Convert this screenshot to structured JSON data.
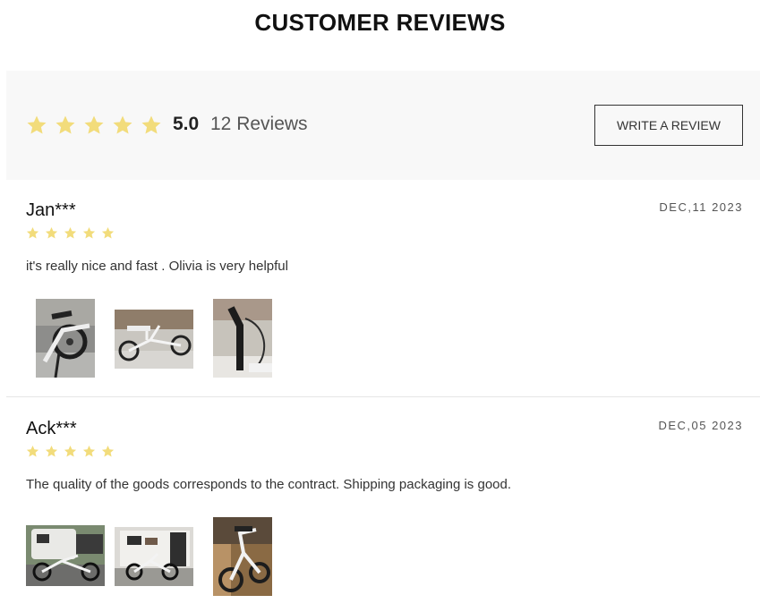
{
  "header": {
    "title": "CUSTOMER REVIEWS"
  },
  "summary": {
    "rating": "5.0",
    "rating_stars": 5,
    "count_text": "12 Reviews",
    "write_button": "WRITE A REVIEW",
    "star_color": "#f2dc7b"
  },
  "reviews": [
    {
      "name": "Jan***",
      "date": "DEC,11 2023",
      "stars": 5,
      "text": "it's really nice and fast . Olivia is very helpful",
      "photos": [
        "bike-rear-wheel-photo",
        "bike-cargo-side-photo",
        "bike-handlebar-photo"
      ]
    },
    {
      "name": "Ack***",
      "date": "DEC,05 2023",
      "stars": 5,
      "text": "The quality of the goods corresponds to the contract. Shipping packaging is good.",
      "photos": [
        "bike-with-caravan-photo",
        "bike-at-caravan-door-photo",
        "bike-indoor-photo"
      ]
    }
  ]
}
